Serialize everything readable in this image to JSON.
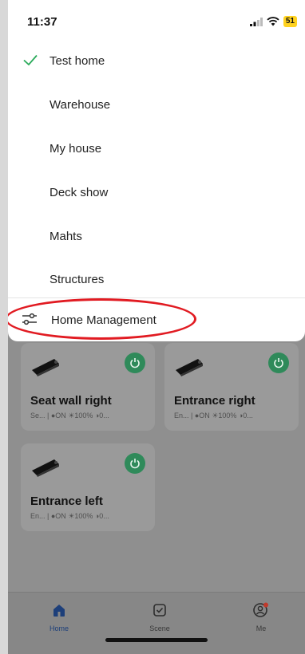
{
  "status_bar": {
    "time": "11:37",
    "battery": "51"
  },
  "home_menu": {
    "items": [
      {
        "label": "Test home",
        "selected": true
      },
      {
        "label": "Warehouse",
        "selected": false
      },
      {
        "label": "My house",
        "selected": false
      },
      {
        "label": "Deck show",
        "selected": false
      },
      {
        "label": "Mahts",
        "selected": false
      },
      {
        "label": "Structures",
        "selected": false
      }
    ],
    "manage_label": "Home Management"
  },
  "devices": [
    {
      "name": "Seat wall right",
      "status": "Se... | ●ON ☀100% ◑0..."
    },
    {
      "name": "Entrance right",
      "status": "En... | ●ON ☀100% ◑0..."
    },
    {
      "name": "Entrance left",
      "status": "En... | ●ON ☀100% ◑0..."
    }
  ],
  "tabs": [
    {
      "label": "Home",
      "icon": "home-icon",
      "active": true
    },
    {
      "label": "Scene",
      "icon": "scene-icon",
      "active": false
    },
    {
      "label": "Me",
      "icon": "profile-icon",
      "active": false,
      "badge": true
    }
  ],
  "colors": {
    "accent_green": "#2aaa5a",
    "annotation_red": "#e11b22",
    "tab_active": "#1d3f7a"
  }
}
